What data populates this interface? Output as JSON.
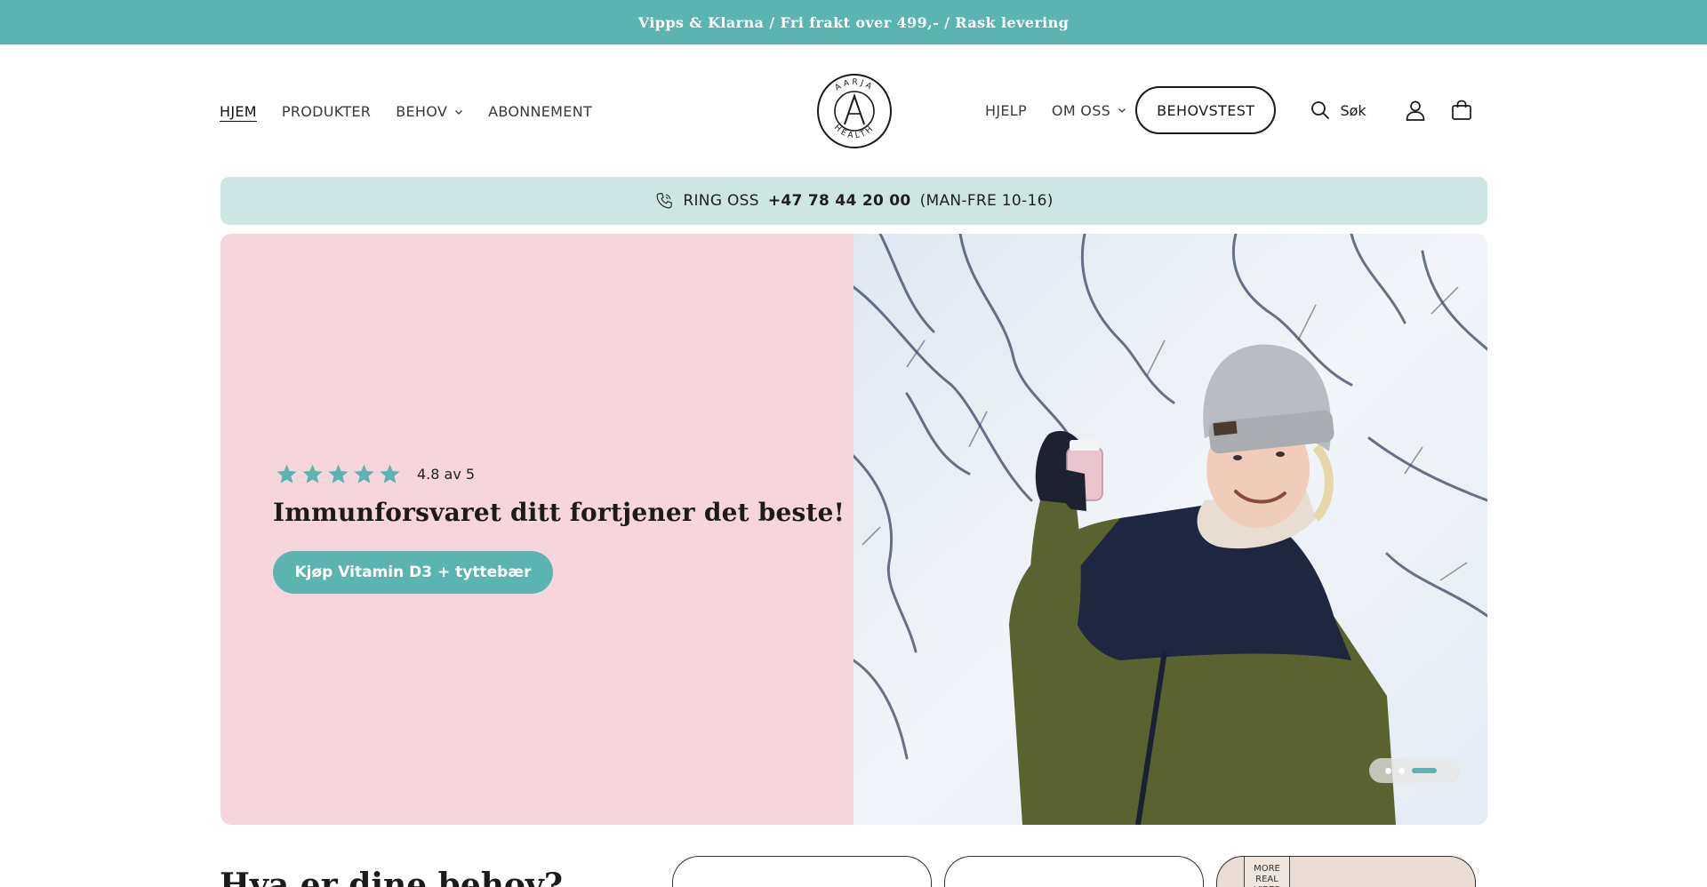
{
  "announcement": {
    "text": "Vipps & Klarna / Fri frakt over 499,- / Rask levering"
  },
  "nav_left": [
    {
      "label": "HJEM",
      "active": true
    },
    {
      "label": "PRODUKTER"
    },
    {
      "label": "BEHOV",
      "dropdown": true
    },
    {
      "label": "ABONNEMENT"
    }
  ],
  "logo": {
    "text_top": "AARJA",
    "text_bottom": "HEALTH",
    "mark": "A"
  },
  "nav_right": {
    "help": "HJELP",
    "about": "OM OSS",
    "cta": "BEHOVSTEST",
    "search": "Søk"
  },
  "phone_bar": {
    "prefix": "RING OSS",
    "number": "+47 78 44 20 00",
    "hours": "(MAN-FRE 10-16)"
  },
  "hero": {
    "rating": 4.8,
    "rating_text": "4.8 av 5",
    "title": "Immunforsvaret ditt fortjener det beste!",
    "button": "Kjøp Vitamin D3 + tyttebær",
    "slides": 3,
    "active_slide": 3
  },
  "behov": {
    "title": "Hva er dine behov?",
    "card_tag": "MORE REAL VIBES"
  },
  "colors": {
    "accent": "#5cb4b1",
    "phone_bar": "#cde6e3",
    "hero_left": "#f7d5dc"
  }
}
